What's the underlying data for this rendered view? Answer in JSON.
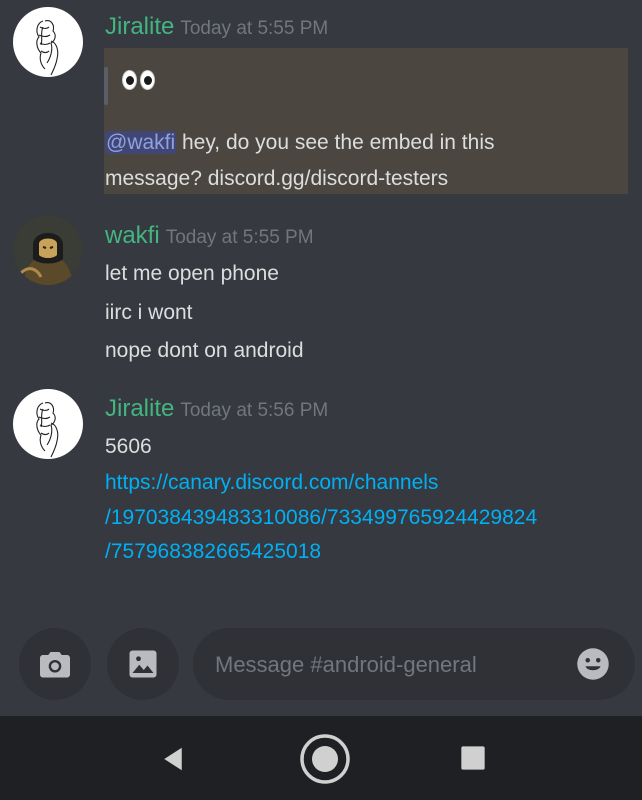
{
  "messages": [
    {
      "author": "Jiralite",
      "timestamp": "Today at 5:55 PM",
      "mention": "@wakfi",
      "line1_rest": " hey, do you see the embed in this",
      "line2": "message? discord.gg/discord-testers"
    },
    {
      "author": "wakfi",
      "timestamp": "Today at 5:55 PM",
      "lines": [
        "let me open phone",
        "iirc i wont",
        "nope dont on android"
      ]
    },
    {
      "author": "Jiralite",
      "timestamp": "Today at 5:56 PM",
      "text": "5606",
      "link_lines": [
        "https://canary.discord.com/channels",
        "/197038439483310086/733499765924429824",
        "/757968382665425018"
      ]
    }
  ],
  "composer": {
    "placeholder": "Message #android-general"
  },
  "colors": {
    "background": "#36393f",
    "username": "#43b581",
    "link": "#00b0f4",
    "mention_bg": "#414675",
    "highlight": "#4b4740"
  },
  "icons": [
    "camera-icon",
    "image-icon",
    "emoji-icon",
    "back-icon",
    "home-icon",
    "recents-icon",
    "eyes-emoji"
  ]
}
